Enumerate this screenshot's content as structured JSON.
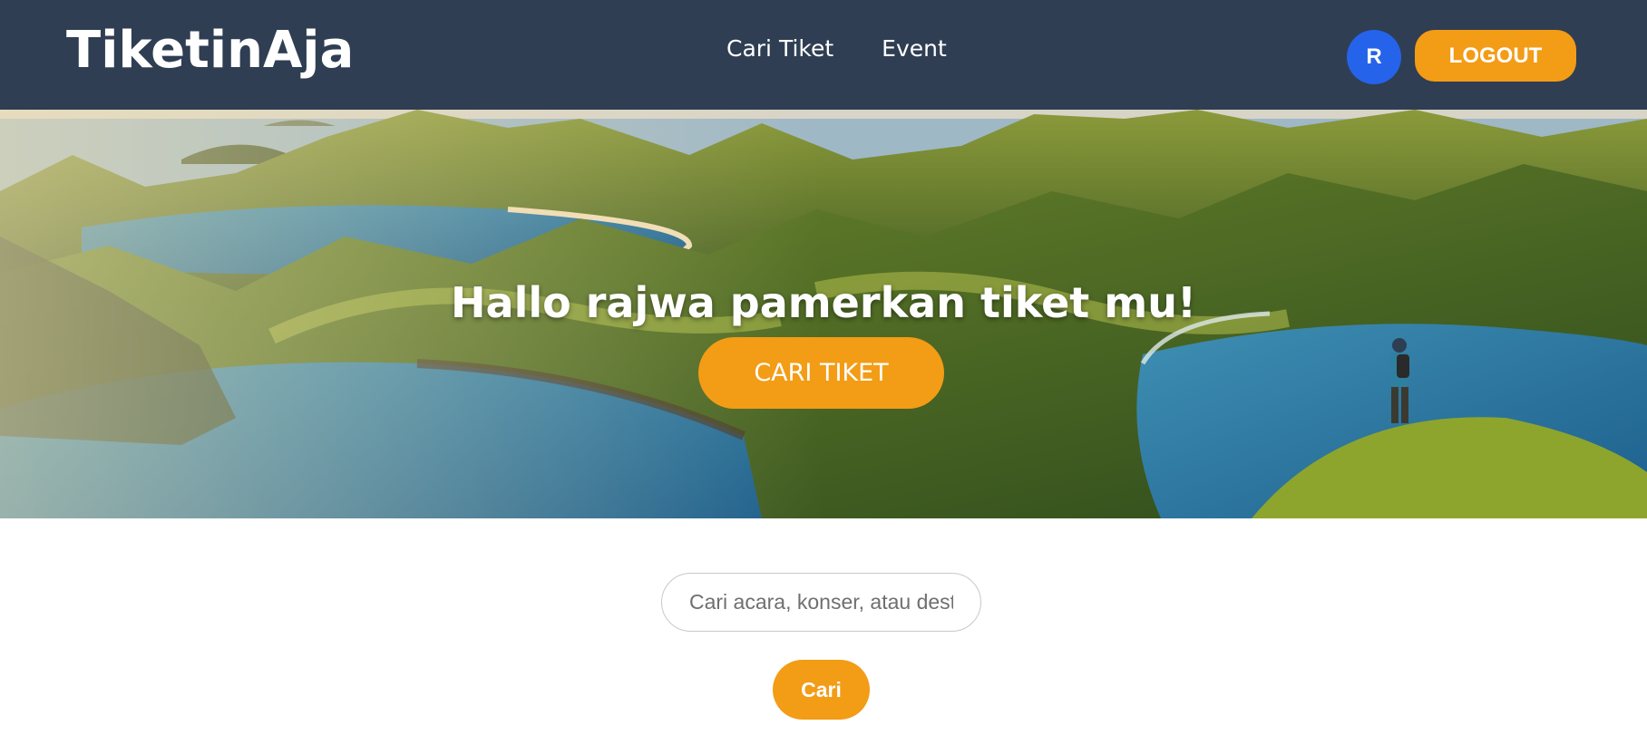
{
  "header": {
    "brand": "TiketinAja",
    "nav": [
      {
        "label": "Cari Tiket"
      },
      {
        "label": "Event"
      }
    ],
    "avatar_initial": "R",
    "logout_label": "LOGOUT"
  },
  "hero": {
    "title": "Hallo rajwa pamerkan tiket mu!",
    "button_label": "CARI TIKET"
  },
  "search": {
    "placeholder": "Cari acara, konser, atau destinasi...",
    "value": "",
    "button_label": "Cari"
  },
  "colors": {
    "navbar": "#2f3e52",
    "accent": "#f39c16",
    "avatar": "#2563eb"
  }
}
